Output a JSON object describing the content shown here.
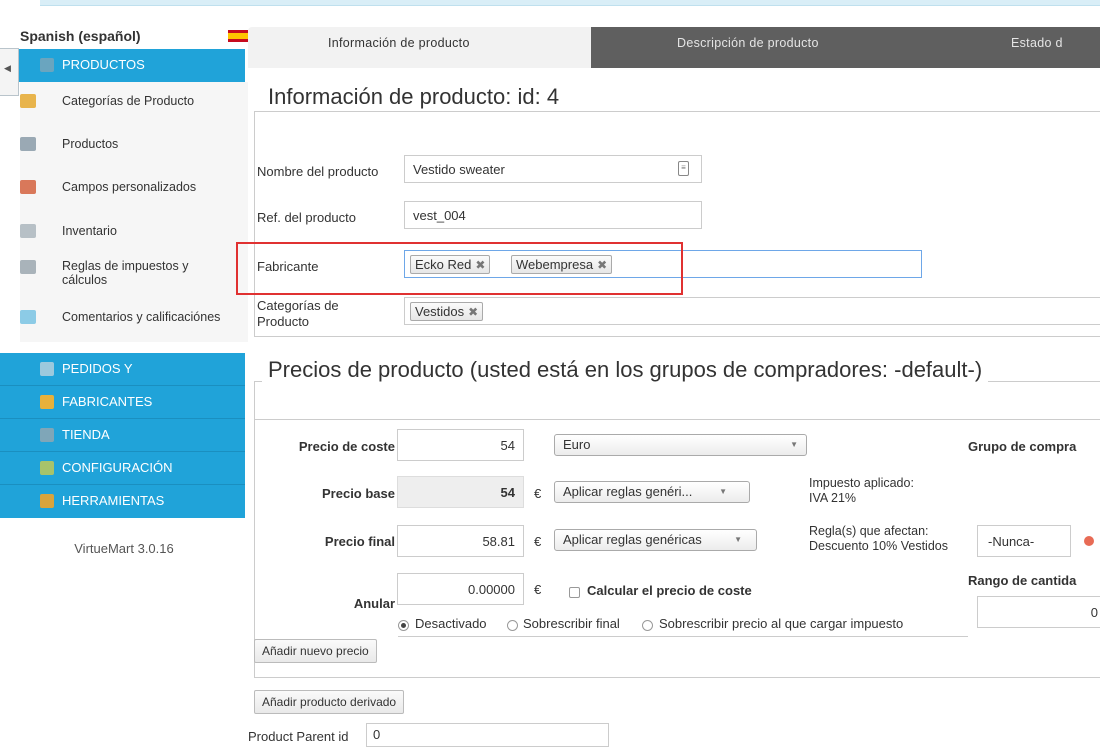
{
  "language": "Spanish (español)",
  "colors": {
    "accent": "#20a3d9",
    "tab_inactive": "#5f5f5f",
    "highlight": "#e03131"
  },
  "sidebar": {
    "products_header": "PRODUCTOS",
    "items": [
      {
        "label": "Categorías de Producto",
        "icon": "folder-icon"
      },
      {
        "label": "Productos",
        "icon": "camera-icon"
      },
      {
        "label": "Campos personalizados",
        "icon": "custom-fields-icon"
      },
      {
        "label": "Inventario",
        "icon": "inventory-icon"
      },
      {
        "label": "Reglas de impuestos y cálculos",
        "icon": "calculator-icon"
      },
      {
        "label": "Comentarios y calificaciónes",
        "icon": "comment-icon"
      }
    ],
    "sections": [
      {
        "label": "PEDIDOS Y",
        "icon": "orders-icon"
      },
      {
        "label": "FABRICANTES",
        "icon": "wrench-icon"
      },
      {
        "label": "TIENDA",
        "icon": "store-icon"
      },
      {
        "label": "CONFIGURACIÓN",
        "icon": "config-icon"
      },
      {
        "label": "HERRAMIENTAS",
        "icon": "tools-icon"
      }
    ],
    "version": "VirtueMart 3.0.16"
  },
  "tabs": [
    "Información de producto",
    "Descripción de producto",
    "Estado d"
  ],
  "info": {
    "title": "Información de producto: id: 4",
    "name_label": "Nombre del producto",
    "name_value": "Vestido sweater",
    "ref_label": "Ref. del producto",
    "ref_value": "vest_004",
    "manufacturer_label": "Fabricante",
    "manufacturers": [
      "Ecko Red",
      "Webempresa"
    ],
    "categories_label_1": "Categorías de",
    "categories_label_2": "Producto",
    "categories": [
      "Vestidos"
    ]
  },
  "prices": {
    "title": "Precios de producto (usted está en los grupos de compradores: -default-)",
    "cost_label": "Precio de coste",
    "cost_value": "54",
    "currency": "Euro",
    "base_label": "Precio base",
    "base_value": "54",
    "euro_sign": "€",
    "base_rule": "Aplicar reglas genéri...",
    "tax_applied_1": "Impuesto aplicado:",
    "tax_applied_2": "IVA 21%",
    "final_label": "Precio final",
    "final_value": "58.81",
    "final_rule": "Aplicar reglas genéricas",
    "rules_affect_1": "Regla(s) que afectan:",
    "rules_affect_2": "Descuento 10% Vestidos",
    "override_label": "Anular",
    "override_value": "0.00000",
    "calc_cost_label": "Calcular el precio de coste",
    "radio_disabled": "Desactivado",
    "radio_overwrite_final": "Sobrescribir final",
    "radio_overwrite_tax": "Sobrescribir precio al que cargar impuesto",
    "buyer_group_label": "Grupo de compra",
    "never_label": "-Nunca-",
    "qty_range_label": "Rango de cantida",
    "qty_value": "0",
    "add_price_button": "Añadir nuevo precio"
  },
  "add_child_button": "Añadir producto derivado",
  "parent_label": "Product Parent id",
  "parent_value": "0"
}
